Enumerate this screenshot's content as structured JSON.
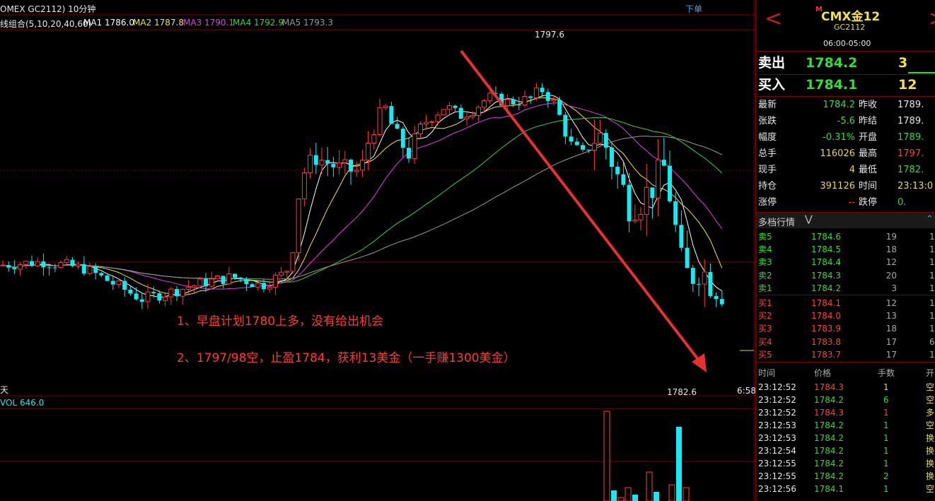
{
  "header": {
    "symbol_line": "OMEX GC2112) 10分钟",
    "download_label": "下单",
    "ma_group_label": "线组合(5,10,20,40,60)",
    "ma": [
      {
        "label": "MA1 1786.0",
        "color": "#ffffff"
      },
      {
        "label": "MA2 1787.8",
        "color": "#f5e04a"
      },
      {
        "label": "MA3 1790.1",
        "color": "#e040e0"
      },
      {
        "label": "MA4 1792.9",
        "color": "#40d040"
      },
      {
        "label": "MA5 1793.3",
        "color": "#9a9a9a"
      }
    ]
  },
  "chart": {
    "high_label": "1797.6",
    "low_label": "1782.6",
    "left_corner_label": "天",
    "right_corner_label": "6:58",
    "volume_label": "VOL 646.0",
    "annotations": [
      "1、早盘计划1780上多，没有给出机会",
      "2、1797/98空，止盈1784，获利13美金（一手赚1300美金）"
    ],
    "colors": {
      "up": "#ff3a3a",
      "down": "#18e8f0",
      "arrow": "#e83030",
      "grid": "#7a0000"
    }
  },
  "chart_data": {
    "type": "candlestick",
    "price_range": [
      1778.6,
      1799.4
    ],
    "high": 1797.6,
    "low": 1782.6,
    "annotated_trade": {
      "entry": "1797/98",
      "direction": "short",
      "exit": 1784,
      "profit": 13
    }
  },
  "side": {
    "nav_prev": "<",
    "nav_next": ">",
    "title_marker": "M",
    "title": "CMX金12",
    "code": "GC2112",
    "session": "06:00-05:00",
    "ask_label": "卖出",
    "ask_price": "1784.2",
    "ask_size": "3",
    "bid_label": "买入",
    "bid_price": "1784.1",
    "bid_size": "12",
    "stats": [
      {
        "l1": "最新",
        "v1": "1784.2",
        "c1": "#33dd33",
        "l2": "昨收",
        "v2": "1789.",
        "c2": "#e8e8e8"
      },
      {
        "l1": "张跌",
        "v1": "-5.6",
        "c1": "#33dd33",
        "l2": "昨结",
        "v2": "1789.",
        "c2": "#e8e8e8"
      },
      {
        "l1": "幅度",
        "v1": "-0.31%",
        "c1": "#33dd33",
        "l2": "开盘",
        "v2": "1789.",
        "c2": "#33dd33"
      },
      {
        "l1": "总手",
        "v1": "116026",
        "c1": "#e8d84a",
        "l2": "最高",
        "v2": "1797.",
        "c2": "#ff4040"
      },
      {
        "l1": "现手",
        "v1": "4",
        "c1": "#e8d84a",
        "l2": "最低",
        "v2": "1782.",
        "c2": "#33dd33"
      },
      {
        "l1": "持仓",
        "v1": "391126",
        "c1": "#e8d84a",
        "l2": "时间",
        "v2": "23:13:0",
        "c2": "#e8d84a"
      },
      {
        "l1": "涨停",
        "v1": "--",
        "c1": "#ff4040",
        "l2": "跌停",
        "v2": "0.",
        "c2": "#33dd33"
      }
    ],
    "depth_title": "多档行情",
    "sells": [
      {
        "label": "卖5",
        "price": "1784.6",
        "qty": "19",
        "extra": "1"
      },
      {
        "label": "卖4",
        "price": "1784.5",
        "qty": "18",
        "extra": "1"
      },
      {
        "label": "卖3",
        "price": "1784.4",
        "qty": "12",
        "extra": "1"
      },
      {
        "label": "卖2",
        "price": "1784.3",
        "qty": "20",
        "extra": "1"
      },
      {
        "label": "卖1",
        "price": "1784.2",
        "qty": "3",
        "extra": "1"
      }
    ],
    "buys": [
      {
        "label": "买1",
        "price": "1784.1",
        "qty": "12",
        "extra": "1"
      },
      {
        "label": "买2",
        "price": "1784.0",
        "qty": "13",
        "extra": "1"
      },
      {
        "label": "买3",
        "price": "1783.9",
        "qty": "18",
        "extra": "1"
      },
      {
        "label": "买4",
        "price": "1783.8",
        "qty": "17",
        "extra": "6"
      },
      {
        "label": "买5",
        "price": "1783.7",
        "qty": "17",
        "extra": "1"
      }
    ],
    "ticks_header": {
      "time": "时间",
      "price": "价格",
      "hands": "手数",
      "type": "开"
    },
    "ticks": [
      {
        "time": "23:12:52",
        "price": "1784.3",
        "hands": "1",
        "type": "空",
        "hc": "#e8d84a",
        "tc": "#e8d84a"
      },
      {
        "time": "23:12:52",
        "price": "1784.2",
        "hands": "6",
        "type": "空",
        "hc": "#33dd33",
        "tc": "#e8d84a"
      },
      {
        "time": "23:12:52",
        "price": "1784.3",
        "hands": "1",
        "type": "多",
        "hc": "#ff4040",
        "tc": "#e8d84a"
      },
      {
        "time": "23:12:53",
        "price": "1784.2",
        "hands": "1",
        "type": "空",
        "hc": "#33dd33",
        "tc": "#e8d84a"
      },
      {
        "time": "23:12:53",
        "price": "1784.2",
        "hands": "1",
        "type": "换",
        "hc": "#33dd33",
        "tc": "#e8d84a"
      },
      {
        "time": "23:12:54",
        "price": "1784.2",
        "hands": "1",
        "type": "换",
        "hc": "#33dd33",
        "tc": "#e8d84a"
      },
      {
        "time": "23:12:55",
        "price": "1784.2",
        "hands": "1",
        "type": "换",
        "hc": "#33dd33",
        "tc": "#e8d84a"
      },
      {
        "time": "23:12:55",
        "price": "1784.2",
        "hands": "2",
        "type": "换",
        "hc": "#33dd33",
        "tc": "#e8d84a"
      },
      {
        "time": "23:12:56",
        "price": "1784.1",
        "hands": "1",
        "type": "空",
        "hc": "#33dd33",
        "tc": "#e8d84a"
      }
    ]
  }
}
